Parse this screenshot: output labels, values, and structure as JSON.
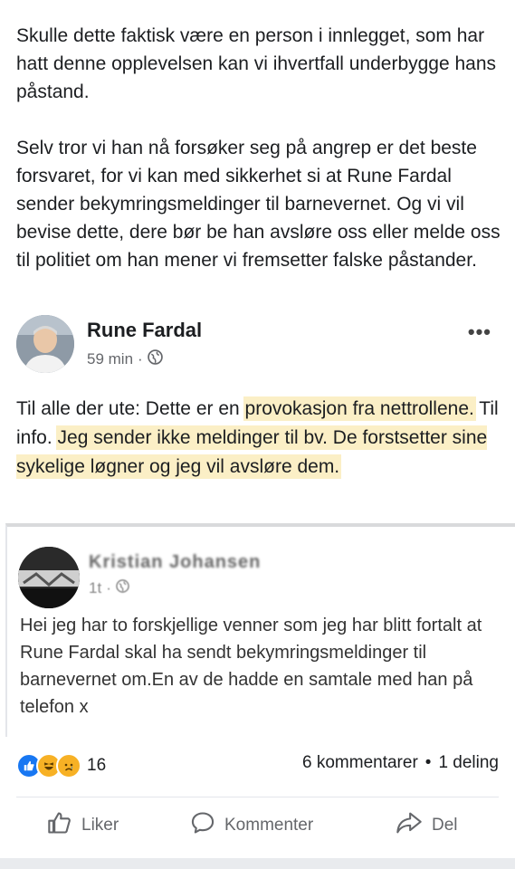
{
  "intro": {
    "p1": "Skulle dette faktisk være en person i innlegget, som har hatt denne opplevelsen kan vi ihvertfall underbygge hans påstand.",
    "p2": "Selv tror vi han nå forsøker seg på angrep er det beste forsvaret, for vi kan med sikkerhet si at Rune Fardal sender bekymringsmeldinger til barnevernet. Og vi vil bevise dette, dere bør be han avsløre oss eller melde oss til politiet om han mener vi fremsetter falske påstander."
  },
  "post": {
    "author": "Rune Fardal",
    "time": "59 min",
    "separator": "·",
    "more": "•••",
    "text_a": "Til alle der ute: Dette er en ",
    "text_hl1": "provokasjon fra nettrollene.",
    "text_b": " Til info. ",
    "text_hl2": "Jeg sender ikke meldinger til bv. De forstsetter  sine sykelige løgner og jeg vil avsløre dem."
  },
  "shared": {
    "author": "Kristian Johansen",
    "time": "1t",
    "separator": "·",
    "text": "Hei jeg har to forskjellige venner som jeg har blitt fortalt at Rune Fardal skal ha sendt bekymringsmeldinger til barnevernet om.En av de hadde en samtale med han på telefon x"
  },
  "stats": {
    "reaction_icons": [
      "like-icon",
      "haha-icon",
      "sad-icon"
    ],
    "reaction_count": "16",
    "comments": "6 kommentarer",
    "dot": "•",
    "shares": "1 deling"
  },
  "actions": {
    "like": "Liker",
    "comment": "Kommenter",
    "share": "Del"
  },
  "colors": {
    "highlight": "#fbefc6",
    "like_blue": "#1877f2",
    "reaction_yellow": "#f7b125",
    "muted": "#65676b"
  }
}
